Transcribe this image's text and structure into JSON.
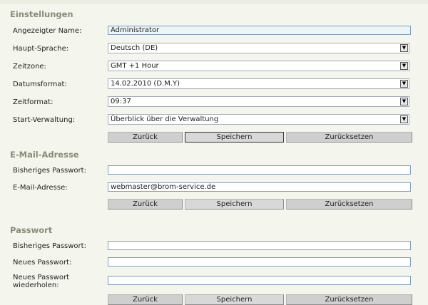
{
  "settings": {
    "title": "Einstellungen",
    "display_name_label": "Angezeigter Name:",
    "display_name_value": "Administrator",
    "language_label": "Haupt-Sprache:",
    "language_value": "Deutsch (DE)",
    "timezone_label": "Zeitzone:",
    "timezone_value": "GMT +1 Hour",
    "dateformat_label": "Datumsformat:",
    "dateformat_value": "14.02.2010 (D.M.Y)",
    "timeformat_label": "Zeitformat:",
    "timeformat_value": "09:37",
    "start_label": "Start-Verwaltung:",
    "start_value": "Überblick über die Verwaltung"
  },
  "email": {
    "title": "E-Mail-Adresse",
    "old_password_label": "Bisheriges Passwort:",
    "old_password_value": "",
    "email_label": "E-Mail-Adresse:",
    "email_value": "webmaster@brom-service.de"
  },
  "password": {
    "title": "Passwort",
    "old_password_label": "Bisheriges Passwort:",
    "new_password_label": "Neues Passwort:",
    "repeat_password_label_line1": "Neues Passwort",
    "repeat_password_label_line2": "wiederholen:"
  },
  "buttons": {
    "back": "Zurück",
    "save": "Speichern",
    "reset": "Zurücksetzen"
  }
}
